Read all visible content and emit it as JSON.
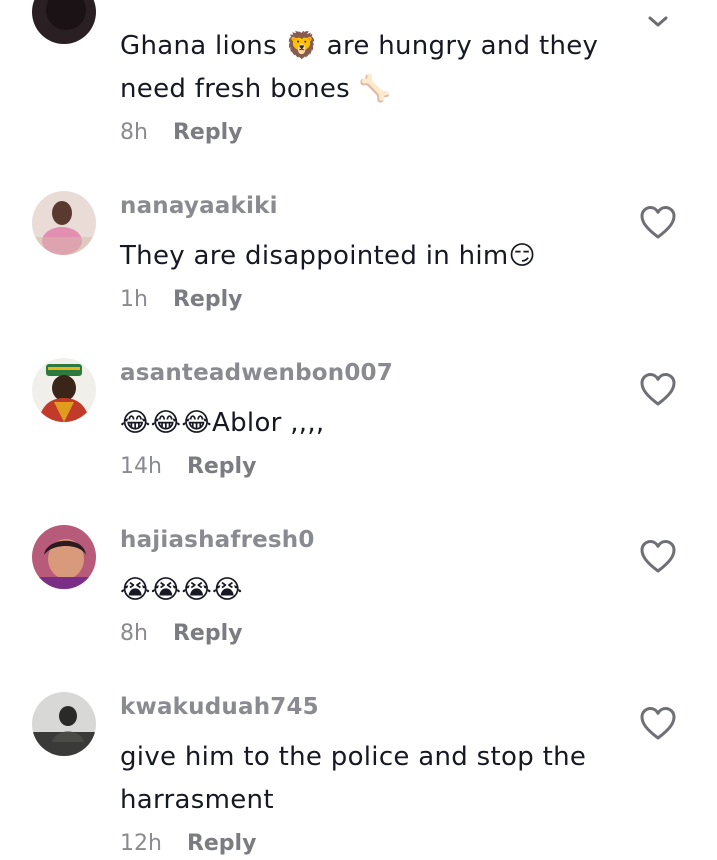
{
  "comments": [
    {
      "username": "",
      "text": "Ghana lions 🦁 are hungry and they need fresh bones 🦴",
      "time": "8h",
      "reply_label": "Reply"
    },
    {
      "username": "nanayaakiki",
      "text": "They are disappointed in him😏",
      "time": "1h",
      "reply_label": "Reply"
    },
    {
      "username": "asanteadwenbon007",
      "text": "😂😂😂Ablor ,,,,",
      "time": "14h",
      "reply_label": "Reply"
    },
    {
      "username": "hajiashafresh0",
      "text": "😭😭😭😭",
      "time": "8h",
      "reply_label": "Reply"
    },
    {
      "username": "kwakuduah745",
      "text": "give him to the police and stop the harrasment",
      "time": "12h",
      "reply_label": "Reply"
    }
  ],
  "icons": {
    "like": "heart-outline-icon",
    "expand": "chevron-down-icon"
  },
  "colors": {
    "text": "#161823",
    "muted": "#8a8b91",
    "background": "#ffffff"
  }
}
